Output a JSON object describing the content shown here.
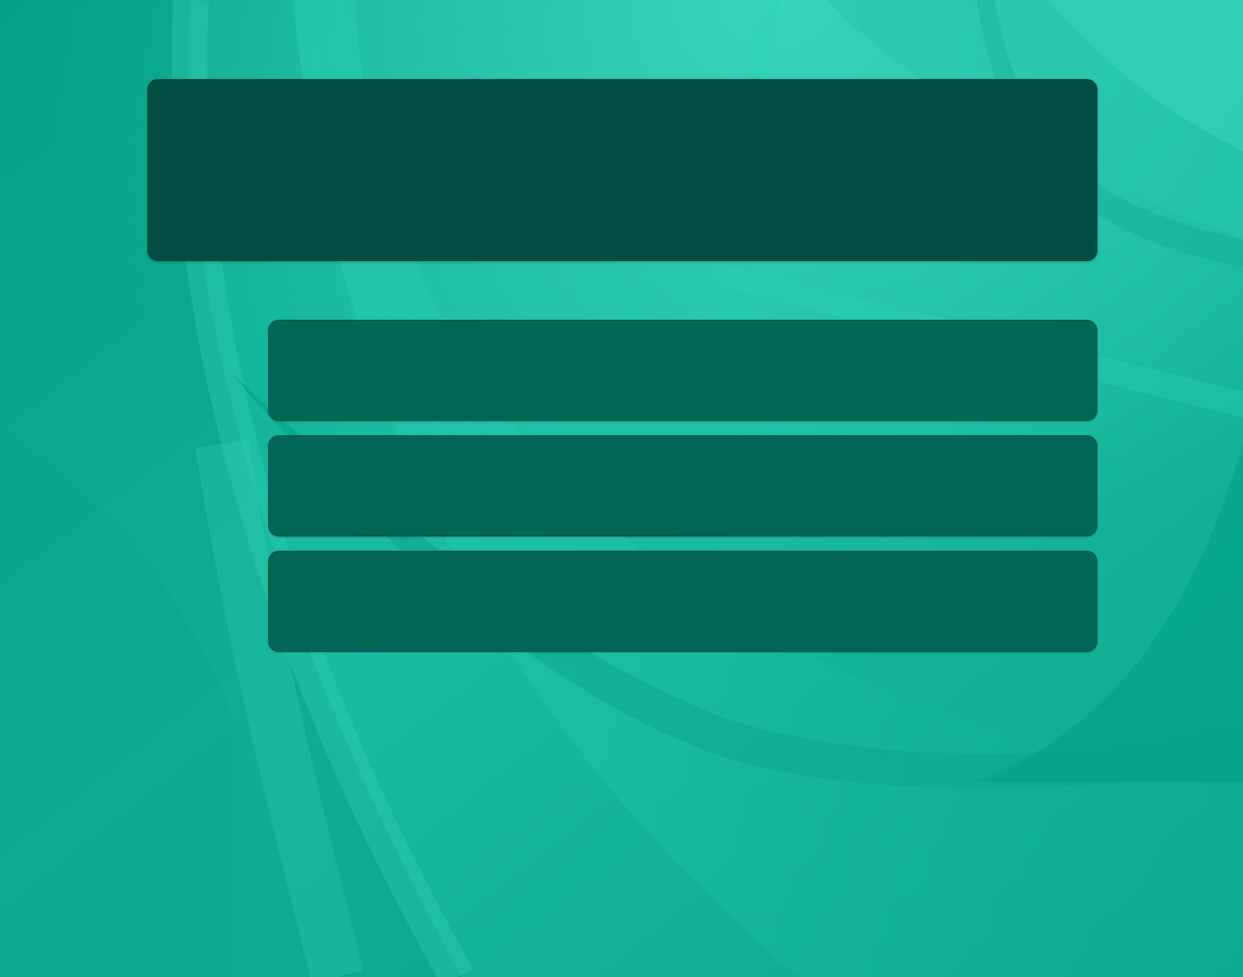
{
  "desktop": {
    "colors": {
      "wallpaper_base": "#0fae93",
      "wallpaper_light": "#36d3b9",
      "wallpaper_dark": "#00967d",
      "header_panel": "#024e44",
      "row_panel": "#026657"
    }
  },
  "panels": {
    "header": {},
    "rows": [
      {},
      {},
      {}
    ]
  }
}
